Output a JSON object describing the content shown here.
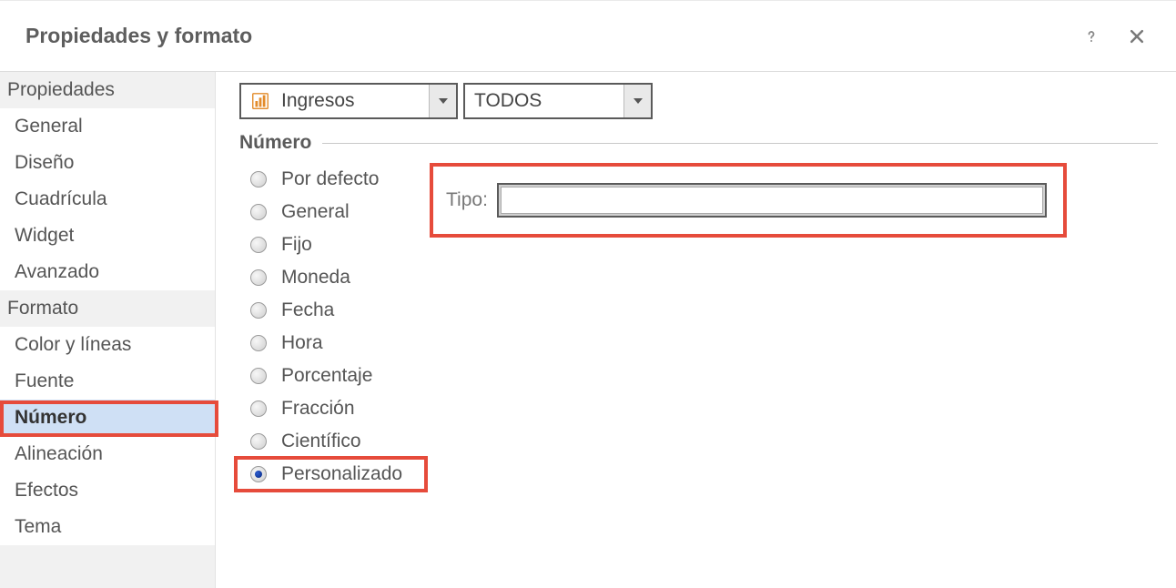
{
  "title": "Propiedades y formato",
  "sidebar": {
    "sections": [
      {
        "header": "Propiedades",
        "items": [
          {
            "label": "General"
          },
          {
            "label": "Diseño"
          },
          {
            "label": "Cuadrícula"
          },
          {
            "label": "Widget"
          },
          {
            "label": "Avanzado"
          }
        ]
      },
      {
        "header": "Formato",
        "items": [
          {
            "label": "Color y líneas"
          },
          {
            "label": "Fuente"
          },
          {
            "label": "Número",
            "active": true,
            "highlight": true
          },
          {
            "label": "Alineación"
          },
          {
            "label": "Efectos"
          },
          {
            "label": "Tema"
          }
        ]
      }
    ]
  },
  "selectors": {
    "primary": "Ingresos",
    "secondary": "TODOS"
  },
  "fieldset_title": "Número",
  "tipo_label": "Tipo:",
  "tipo_value": "",
  "radios": [
    {
      "label": "Por defecto",
      "checked": false
    },
    {
      "label": "General",
      "checked": false
    },
    {
      "label": "Fijo",
      "checked": false
    },
    {
      "label": "Moneda",
      "checked": false
    },
    {
      "label": "Fecha",
      "checked": false
    },
    {
      "label": "Hora",
      "checked": false
    },
    {
      "label": "Porcentaje",
      "checked": false
    },
    {
      "label": "Fracción",
      "checked": false
    },
    {
      "label": "Científico",
      "checked": false
    },
    {
      "label": "Personalizado",
      "checked": true,
      "highlight": true
    }
  ]
}
